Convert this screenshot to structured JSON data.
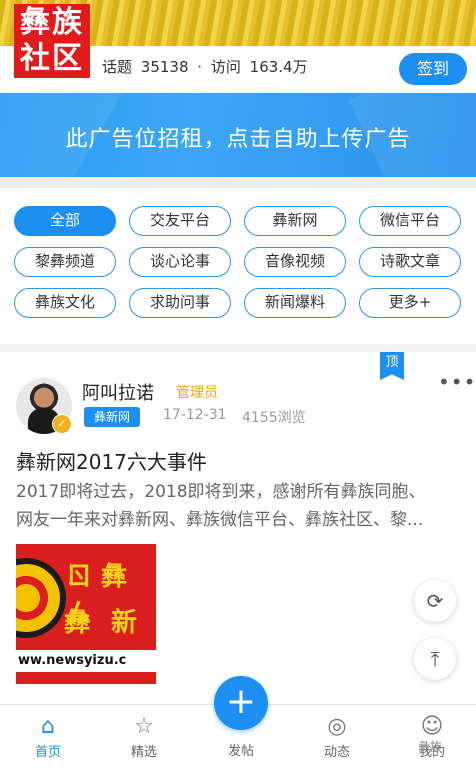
{
  "header": {
    "logo_line1": "彝族",
    "logo_line2": "社区",
    "topics_label": "话题",
    "topics_count": "35138",
    "dot": "·",
    "visits_label": "访问",
    "visits_count": "163.4万",
    "signin_label": "签到"
  },
  "ad": {
    "text": "此广告位招租，点击自助上传广告"
  },
  "categories": [
    {
      "label": "全部",
      "active": true
    },
    {
      "label": "交友平台"
    },
    {
      "label": "彝新网"
    },
    {
      "label": "微信平台"
    },
    {
      "label": "黎彝频道"
    },
    {
      "label": "谈心论事"
    },
    {
      "label": "音像视频"
    },
    {
      "label": "诗歌文章"
    },
    {
      "label": "彝族文化"
    },
    {
      "label": "求助问事"
    },
    {
      "label": "新闻爆料"
    },
    {
      "label": "更多+"
    }
  ],
  "post": {
    "pin_label": "顶",
    "more_label": "•••",
    "author": "阿叫拉诺",
    "role": "管理员",
    "tag": "彝新网",
    "date": "17-12-31",
    "views": "4155浏览",
    "title": "彝新网2017六大事件",
    "excerpt_line1": "2017即将过去，2018即将到来，感谢所有彝族同胞、",
    "excerpt_line2": "网友一年来对彝新网、彝族微信平台、彝族社区、黎...",
    "thumb_text1": "ㄖ 彝 ㄙ",
    "thumb_text2": "彝 新",
    "thumb_url": "ww.newsyizu.c"
  },
  "floating": {
    "refresh_icon": "refresh-icon",
    "top_icon": "back-to-top-icon"
  },
  "nav": {
    "home": "首页",
    "featured": "精选",
    "post": "发帖",
    "activity": "动态",
    "me": "我的"
  },
  "watermark": "彝族"
}
